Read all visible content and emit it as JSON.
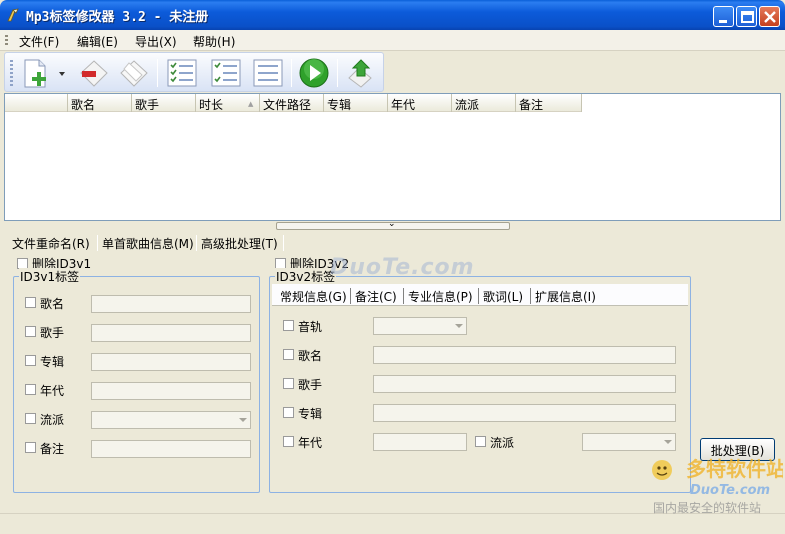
{
  "window": {
    "title": "Mp3标签修改器 3.2 - 未注册"
  },
  "menu": {
    "file": "文件(F)",
    "edit": "编辑(E)",
    "export": "导出(X)",
    "help": "帮助(H)"
  },
  "toolbar": {
    "icons": [
      "add-file-icon",
      "remove-icon",
      "clear-icon",
      "check-list-icon",
      "check-list-2-icon",
      "list-icon",
      "play-icon",
      "export-icon"
    ]
  },
  "list": {
    "columns": [
      "歌名",
      "歌手",
      "时长",
      "文件路径",
      "专辑",
      "年代",
      "流派",
      "备注"
    ]
  },
  "tabs": {
    "rename": "文件重命名(R)",
    "single": "单首歌曲信息(M)",
    "advanced": "高级批处理(T)"
  },
  "id3v1": {
    "delete_label": "删除ID3v1",
    "group_label": "ID3v1标签",
    "fields": [
      "歌名",
      "歌手",
      "专辑",
      "年代",
      "流派",
      "备注"
    ]
  },
  "id3v2": {
    "delete_label": "删除ID3v2",
    "group_label": "ID3v2标签",
    "subtabs": [
      "常规信息(G)",
      "备注(C)",
      "专业信息(P)",
      "歌词(L)",
      "扩展信息(I)"
    ],
    "fields": {
      "track": "音轨",
      "title": "歌名",
      "artist": "歌手",
      "album": "专辑",
      "year": "年代",
      "genre": "流派"
    }
  },
  "actions": {
    "batch": "批处理(B)"
  },
  "watermark": {
    "text": "DuoTe.com",
    "logo_cn": "多特软件站",
    "logo_en": "DuoTe.com",
    "slogan": "国内最安全的软件站"
  }
}
